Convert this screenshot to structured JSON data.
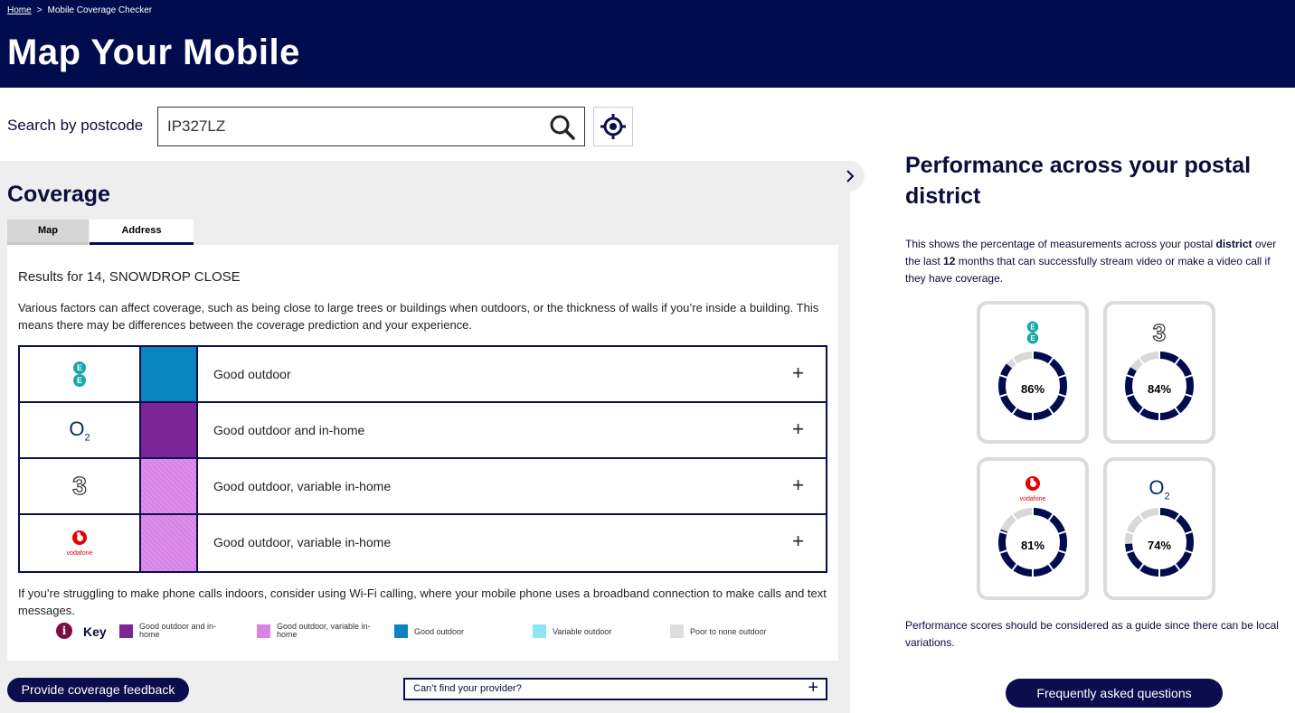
{
  "breadcrumb": {
    "home": "Home",
    "separator": ">",
    "current": "Mobile Coverage Checker"
  },
  "header": {
    "title": "Map Your Mobile"
  },
  "search": {
    "label": "Search by postcode",
    "value": "IP327LZ"
  },
  "coverage": {
    "title": "Coverage",
    "tabs": [
      {
        "label": "Map",
        "active": false
      },
      {
        "label": "Address",
        "active": true
      }
    ],
    "results_title": "Results for 14, SNOWDROP CLOSE",
    "disclaimer": "Various factors can affect coverage, such as being close to large trees or buildings when outdoors, or the thickness of walls if you’re inside a building. This means there may be differences between the coverage prediction and your experience.",
    "rows": [
      {
        "provider": "EE",
        "status": "Good outdoor",
        "color": "#0a84c1",
        "expand": "+"
      },
      {
        "provider": "O2",
        "status": "Good outdoor and in-home",
        "color": "#7b2596",
        "expand": "+"
      },
      {
        "provider": "Three",
        "status": "Good outdoor, variable in-home",
        "color": "#d884e6",
        "expand": "+"
      },
      {
        "provider": "Vodafone",
        "status": "Good outdoor, variable in-home",
        "color": "#d884e6",
        "expand": "+"
      }
    ],
    "wifi_note": "If you’re struggling to make phone calls indoors, consider using Wi-Fi calling, where your mobile phone uses a broadband connection to make calls and text messages.",
    "key": {
      "info_glyph": "i",
      "label": "Key",
      "items": [
        {
          "label": "Good outdoor and in-home",
          "color": "#7b2596"
        },
        {
          "label": "Good outdoor, variable in-home",
          "color": "#d884e6"
        },
        {
          "label": "Good outdoor",
          "color": "#0a84c1"
        },
        {
          "label": "Variable outdoor",
          "color": "#8be7f6"
        },
        {
          "label": "Poor to none outdoor",
          "color": "#dedede"
        }
      ]
    },
    "feedback_button": "Provide coverage feedback",
    "provider_button": {
      "label": "Can’t find your provider?",
      "icon": "+"
    }
  },
  "performance": {
    "title": "Performance across your postal district",
    "description_parts": {
      "p1": "This shows the percentage of measurements across your postal ",
      "b1": "district",
      "p2": " over the last ",
      "b2": "12",
      "p3": " months that can successfully stream video or make a video call if they have coverage."
    },
    "cards": [
      {
        "provider": "EE",
        "value": 86,
        "label": "86%"
      },
      {
        "provider": "Three",
        "value": 84,
        "label": "84%"
      },
      {
        "provider": "Vodafone",
        "value": 81,
        "label": "81%"
      },
      {
        "provider": "O2",
        "value": 74,
        "label": "74%"
      }
    ],
    "note": "Performance scores should be considered as a guide since there can be local variations.",
    "faq_button": "Frequently asked questions"
  },
  "logos": {
    "o2_main": "O",
    "o2_sub": "2",
    "three": "3",
    "vodafone": "vodafone"
  },
  "colors": {
    "navy": "#000c4e",
    "ee_teal": "#1aa7a7",
    "vodafone_red": "#e60000",
    "donut_track": "#d8d8d8"
  }
}
